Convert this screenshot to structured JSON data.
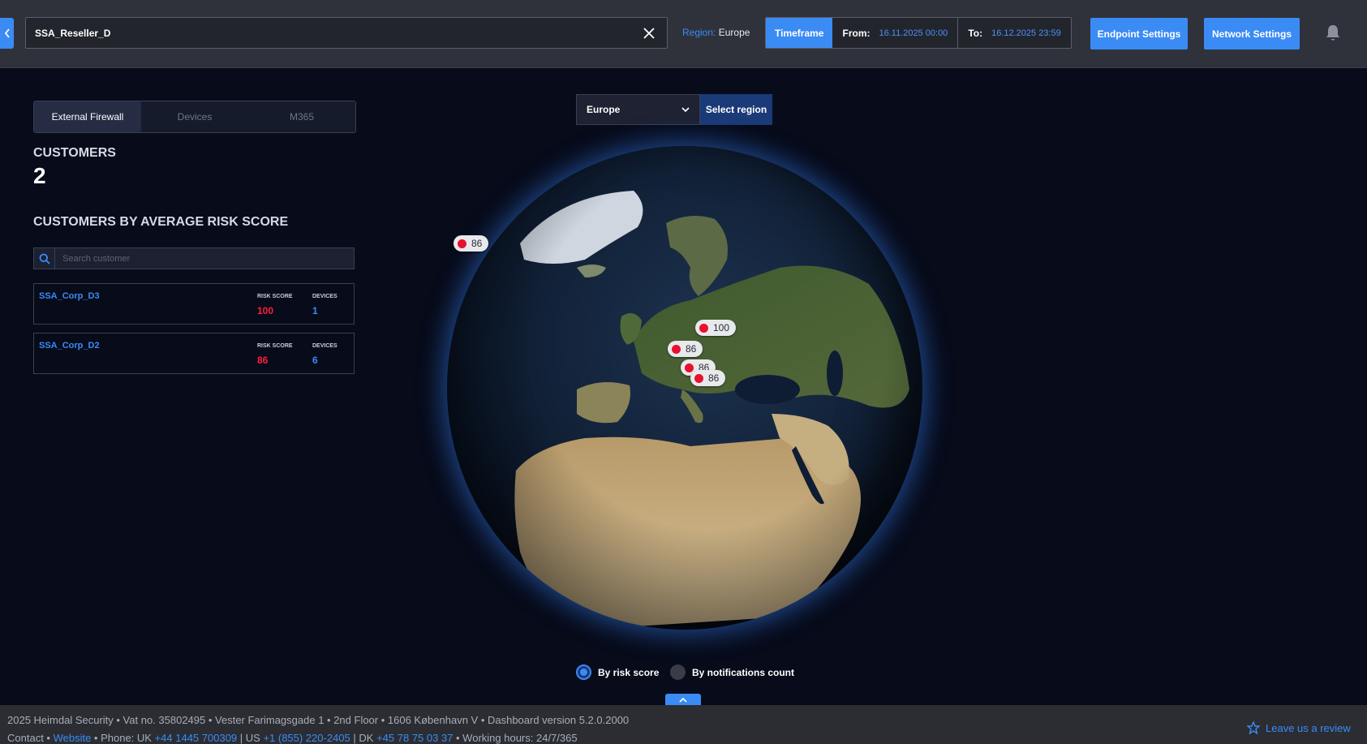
{
  "header": {
    "search_value": "SSA_Reseller_D",
    "region_label": "Region:",
    "region_value": "Europe",
    "timeframe_label": "Timeframe",
    "from_label": "From:",
    "from_value": "16.11.2025 00:00",
    "to_label": "To:",
    "to_value": "16.12.2025 23:59",
    "endpoint_settings": "Endpoint Settings",
    "network_settings": "Network Settings"
  },
  "tabs": [
    {
      "label": "External Firewall",
      "active": true
    },
    {
      "label": "Devices",
      "active": false
    },
    {
      "label": "M365",
      "active": false
    }
  ],
  "customers": {
    "label": "CUSTOMERS",
    "count": "2"
  },
  "risk_section": {
    "title": "CUSTOMERS BY AVERAGE RISK SCORE",
    "search_placeholder": "Search customer",
    "risk_label": "RISK SCORE",
    "devices_label": "DEVICES",
    "items": [
      {
        "name": "SSA_Corp_D3",
        "risk_score": "100",
        "devices": "1"
      },
      {
        "name": "SSA_Corp_D2",
        "risk_score": "86",
        "devices": "6"
      }
    ]
  },
  "map": {
    "region_selected": "Europe",
    "select_region_label": "Select region",
    "markers": [
      "86",
      "100",
      "86",
      "86",
      "86"
    ]
  },
  "mode": {
    "risk_label": "By risk score",
    "notif_label": "By notifications count",
    "selected": "risk"
  },
  "footer": {
    "line1": "2025 Heimdal Security • Vat no. 35802495 • Vester Farimagsgade 1 • 2nd Floor • 1606 København V • Dashboard version 5.2.0.2000",
    "contact": "Contact • ",
    "website": "Website",
    "phone_prefix": " • Phone: UK ",
    "phone_uk": "+44 1445 700309",
    "us_prefix": " | US ",
    "phone_us": "+1 (855) 220-2405",
    "dk_prefix": " | DK ",
    "phone_dk": "+45 78 75 03 37",
    "hours": " • Working hours: 24/7/365",
    "review": "Leave us a review"
  },
  "colors": {
    "accent": "#3b8bf5",
    "risk": "#ff1f3d",
    "background": "#070b1a"
  }
}
